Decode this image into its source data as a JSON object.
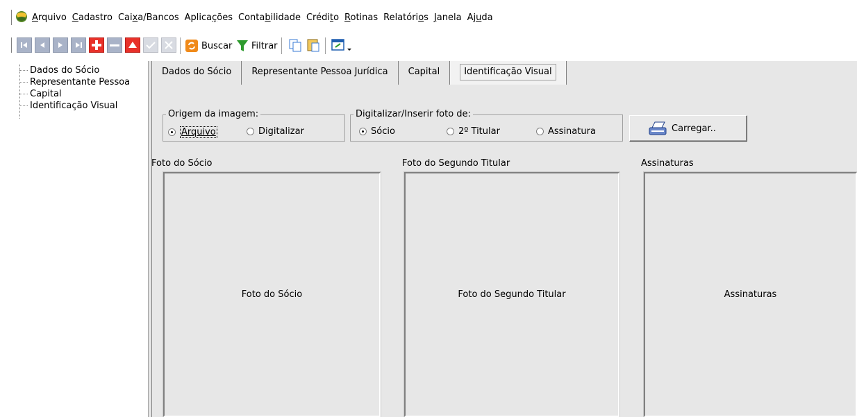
{
  "menubar": {
    "logo_icon": "app-logo-icon",
    "items": [
      "Arquivo",
      "Cadastro",
      "Caixa/Bancos",
      "Aplicações",
      "Contabilidade",
      "Crédito",
      "Rotinas",
      "Relatórios",
      "Janela",
      "Ajuda"
    ]
  },
  "toolbar": {
    "nav_icons": [
      "first-record-icon",
      "prev-record-icon",
      "next-record-icon",
      "last-record-icon"
    ],
    "buscar_label": "Buscar",
    "filtrar_label": "Filtrar"
  },
  "tree": {
    "items": [
      "Dados do Sócio",
      "Representante Pessoa",
      "Capital",
      "Identificação Visual"
    ]
  },
  "tabs": [
    "Dados do Sócio",
    "Representante Pessoa Jurídica",
    "Capital",
    "Identificação Visual"
  ],
  "active_tab": "Identificação Visual",
  "origem": {
    "legend": "Origem da imagem:",
    "options": [
      "Arquivo",
      "Digitalizar"
    ],
    "selected": "Arquivo"
  },
  "digitalizar": {
    "legend": "Digitalizar/Inserir foto de:",
    "options": [
      "Sócio",
      "2º Titular",
      "Assinatura"
    ],
    "selected": "Sócio"
  },
  "carregar_label": "Carregar..",
  "photos": [
    {
      "title": "Foto do Sócio",
      "placeholder": "Foto do Sócio"
    },
    {
      "title": "Foto do Segundo Titular",
      "placeholder": "Foto do Segundo Titular"
    },
    {
      "title": "Assinaturas",
      "placeholder": "Assinaturas"
    }
  ],
  "colors": {
    "panel_bg": "#e7e7e7",
    "nav_button": "#a9b3c8",
    "accent_red": "#e8312a",
    "accent_green": "#2e9b2e",
    "accent_orange": "#f08a1a"
  }
}
